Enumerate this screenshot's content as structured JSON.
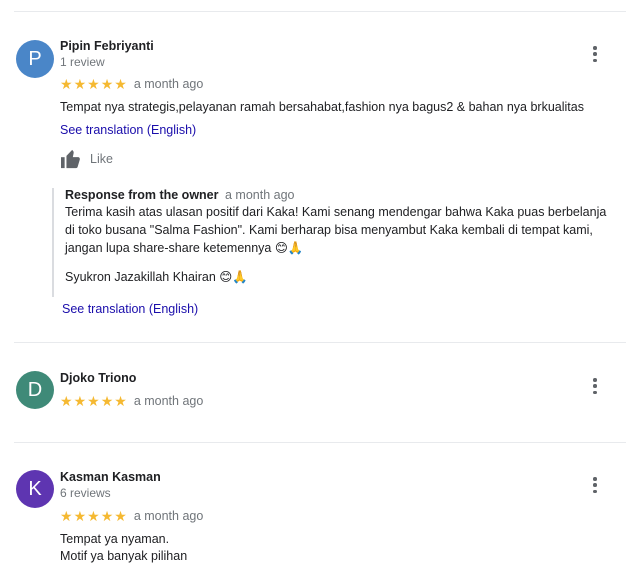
{
  "reviews": [
    {
      "name": "Pipin Febriyanti",
      "avatar_letter": "P",
      "avatar_color": "#4a86c8",
      "review_count": "1 review",
      "rating": 5,
      "date": "a month ago",
      "text": "Tempat nya strategis,pelayanan ramah bersahabat,fashion nya bagus2 & bahan nya brkualitas",
      "translate_label": "See translation (English)",
      "like_label": "Like",
      "owner_response": {
        "title": "Response from the owner",
        "date": "a month ago",
        "text": "Terima kasih atas ulasan positif dari Kaka! Kami senang mendengar bahwa Kaka puas berbelanja di toko busana \"Salma Fashion\". Kami berharap bisa menyambut Kaka kembali di tempat kami, jangan lupa share-share ketemennya 😊🙏",
        "signoff": "Syukron Jazakillah Khairan 😊🙏",
        "translate_label": "See translation (English)"
      }
    },
    {
      "name": "Djoko Triono",
      "avatar_letter": "D",
      "avatar_color": "#3f8a78",
      "rating": 5,
      "date": "a month ago"
    },
    {
      "name": "Kasman Kasman",
      "avatar_letter": "K",
      "avatar_color": "#5e35b1",
      "review_count": "6 reviews",
      "rating": 5,
      "date": "a month ago",
      "text_lines": [
        "Tempat ya nyaman.",
        "Motif ya banyak pilihan"
      ]
    }
  ]
}
